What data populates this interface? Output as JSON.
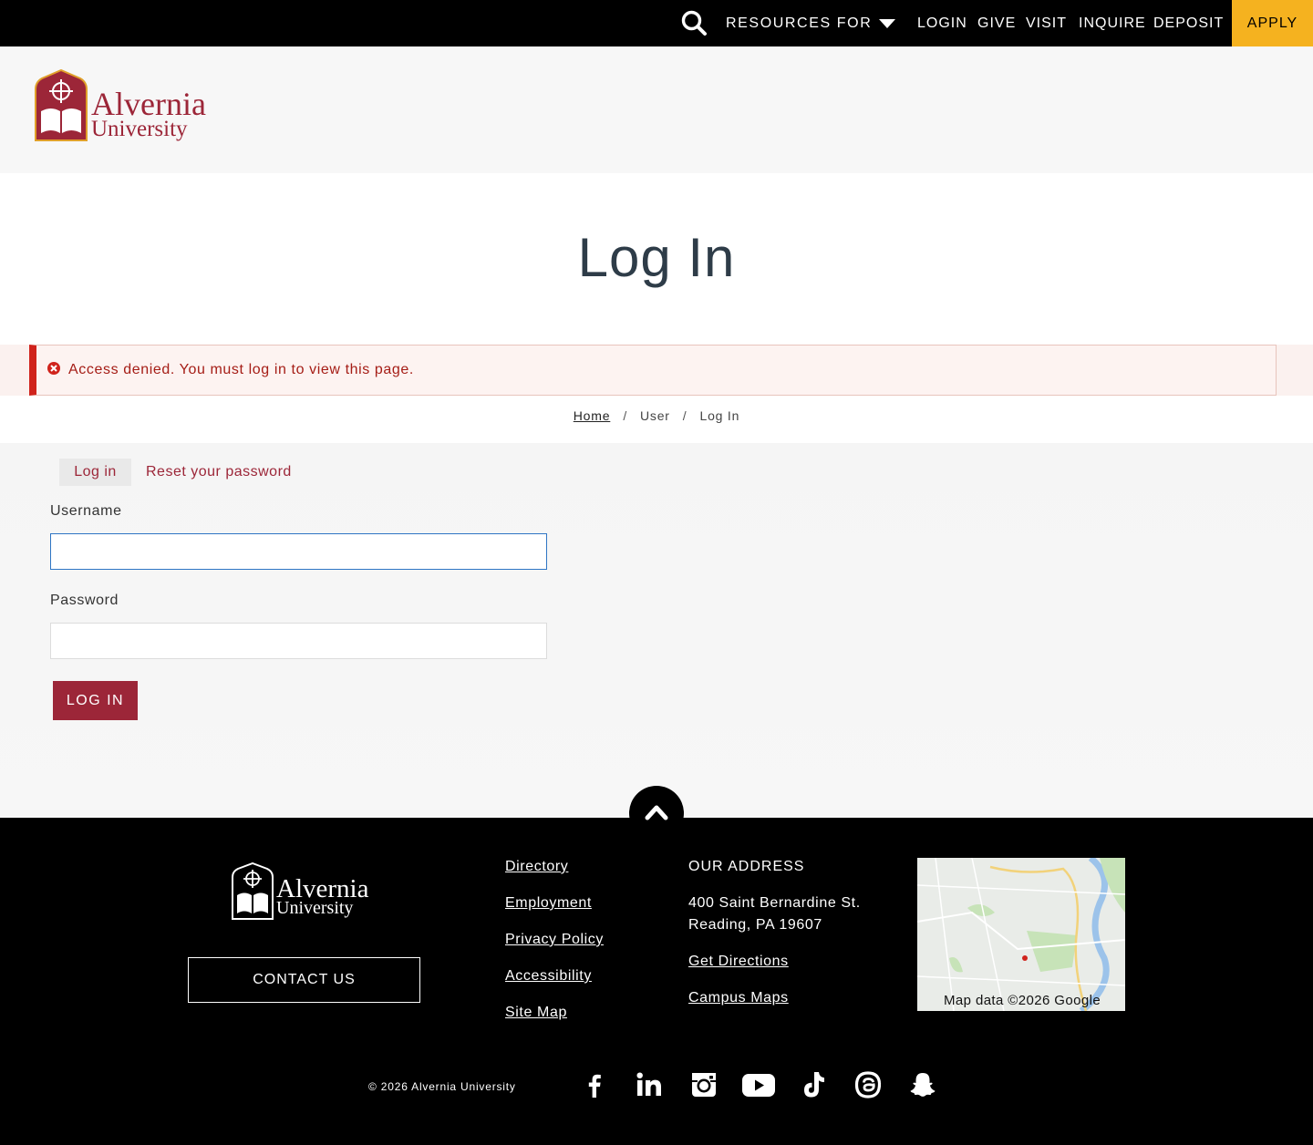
{
  "topbar": {
    "resources_label": "RESOURCES FOR",
    "links": [
      "LOGIN",
      "GIVE",
      "VISIT",
      "INQUIRE",
      "DEPOSIT"
    ],
    "apply_label": "APPLY",
    "accent_color": "#f5b21f"
  },
  "brand": {
    "name_line1": "Alvernia",
    "name_line2": "University",
    "color": "#9c2638"
  },
  "page": {
    "title": "Log In"
  },
  "alert": {
    "message": "Access denied. You must log in to view this page.",
    "color": "#d0231c"
  },
  "breadcrumb": {
    "home": "Home",
    "user": "User",
    "current": "Log In",
    "separator": "/"
  },
  "form": {
    "tabs": [
      "Log in",
      "Reset your password"
    ],
    "username_label": "Username",
    "username_value": "",
    "password_label": "Password",
    "password_value": "",
    "submit_label": "LOG IN"
  },
  "footer": {
    "contact_label": "CONTACT US",
    "links": [
      "Directory",
      "Employment",
      "Privacy Policy",
      "Accessibility",
      "Site Map"
    ],
    "address_heading": "OUR ADDRESS",
    "address_line1": "400 Saint Bernardine St.",
    "address_line2": "Reading, PA 19607",
    "directions": "Get Directions",
    "campus_maps": "Campus Maps",
    "map_credit": "Map data ©2026 Google",
    "copyright": "© 2026 Alvernia University",
    "social": [
      "facebook-icon",
      "linkedin-icon",
      "instagram-icon",
      "youtube-icon",
      "tiktok-icon",
      "threads-icon",
      "snapchat-icon"
    ]
  }
}
